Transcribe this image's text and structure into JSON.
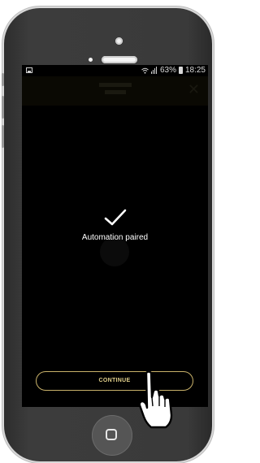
{
  "status_bar": {
    "battery_percent": "63%",
    "time": "18:25",
    "icons": [
      "image-icon",
      "wifi-icon",
      "signal-icon",
      "battery-icon"
    ]
  },
  "main": {
    "message": "Automation paired",
    "status_icon": "checkmark-icon"
  },
  "actions": {
    "continue_label": "CONTINUE"
  },
  "colors": {
    "screen_bg": "#000000",
    "accent": "#c9b26a",
    "text": "#ffffff"
  }
}
